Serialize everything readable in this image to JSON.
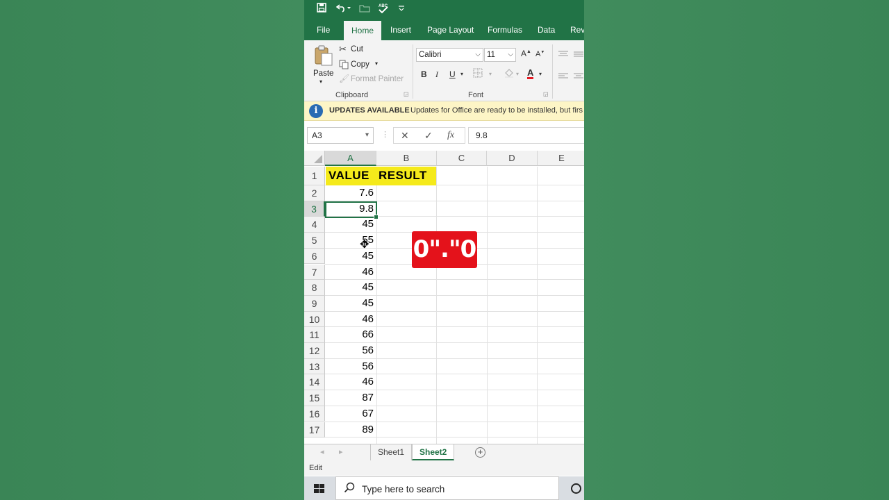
{
  "quick_access": {
    "save_icon": "save-icon",
    "undo_icon": "undo-icon",
    "spelling_icon": "spelling-check-icon",
    "customize_icon": "chevron-down-icon"
  },
  "tabs": [
    "File",
    "Home",
    "Insert",
    "Page Layout",
    "Formulas",
    "Data",
    "Revi"
  ],
  "active_tab": "Home",
  "clipboard": {
    "paste": "Paste",
    "cut": "Cut",
    "copy": "Copy",
    "format_painter": "Format Painter",
    "group_label": "Clipboard"
  },
  "font": {
    "family": "Calibri",
    "size": "11",
    "bold": "B",
    "italic": "I",
    "underline": "U",
    "font_color": "A",
    "grow": "A",
    "shrink": "A",
    "group_label": "Font"
  },
  "update_bar": {
    "title": "UPDATES AVAILABLE",
    "message": "Updates for Office are ready to be installed, but firs"
  },
  "formula_bar": {
    "name_box": "A3",
    "cancel": "✕",
    "enter": "✓",
    "fx": "fx",
    "value": "9.8"
  },
  "columns": [
    "A",
    "B",
    "C",
    "D",
    "E"
  ],
  "rows": [
    "1",
    "2",
    "3",
    "4",
    "5",
    "6",
    "7",
    "8",
    "9",
    "10",
    "11",
    "12",
    "13",
    "14",
    "15",
    "16",
    "17"
  ],
  "headers": {
    "a1": "VALUE",
    "b1": "RESULT"
  },
  "column_a_values": [
    "7.6",
    "9.8",
    "45",
    "55",
    "45",
    "46",
    "45",
    "45",
    "46",
    "66",
    "56",
    "56",
    "46",
    "87",
    "67",
    "89"
  ],
  "selected_cell": "A3",
  "overlay_text": "0\".\"0",
  "sheets": [
    "Sheet1",
    "Sheet2"
  ],
  "active_sheet": "Sheet2",
  "status": "Edit",
  "taskbar": {
    "search_placeholder": "Type here to search"
  },
  "colors": {
    "excel_green": "#217346",
    "header_highlight": "#f5ea1b",
    "overlay_red": "#e4121b",
    "update_bar": "#fdf5c6"
  }
}
